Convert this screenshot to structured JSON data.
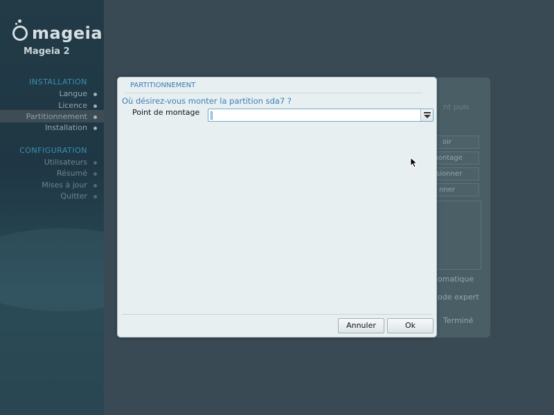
{
  "brand": {
    "name": "mageia",
    "version": "Mageia 2"
  },
  "sidebar": {
    "installation_heading": "INSTALLATION",
    "installation_steps": [
      {
        "label": "Langue"
      },
      {
        "label": "Licence"
      },
      {
        "label": "Partitionnement"
      },
      {
        "label": "Installation"
      }
    ],
    "configuration_heading": "CONFIGURATION",
    "configuration_steps": [
      {
        "label": "Utilisateurs"
      },
      {
        "label": "Résumé"
      },
      {
        "label": "Mises à jour"
      },
      {
        "label": "Quitter"
      }
    ]
  },
  "background": {
    "hint": "nt puis",
    "buttons": [
      "oir",
      "montage",
      "nsionner",
      "nner"
    ],
    "auto": "omatique",
    "expert": "ode expert",
    "done": "Terminé"
  },
  "dialog": {
    "title": "PARTITIONNEMENT",
    "question": "Où désirez-vous monter la partition sda7 ?",
    "mount_label": "Point de montage",
    "mount_value": "",
    "cancel_label": "Annuler",
    "ok_label": "Ok"
  },
  "colors": {
    "accent": "#3a80b8",
    "dialog_bg": "#e8eff0",
    "sidebar_bg": "#223b47"
  }
}
